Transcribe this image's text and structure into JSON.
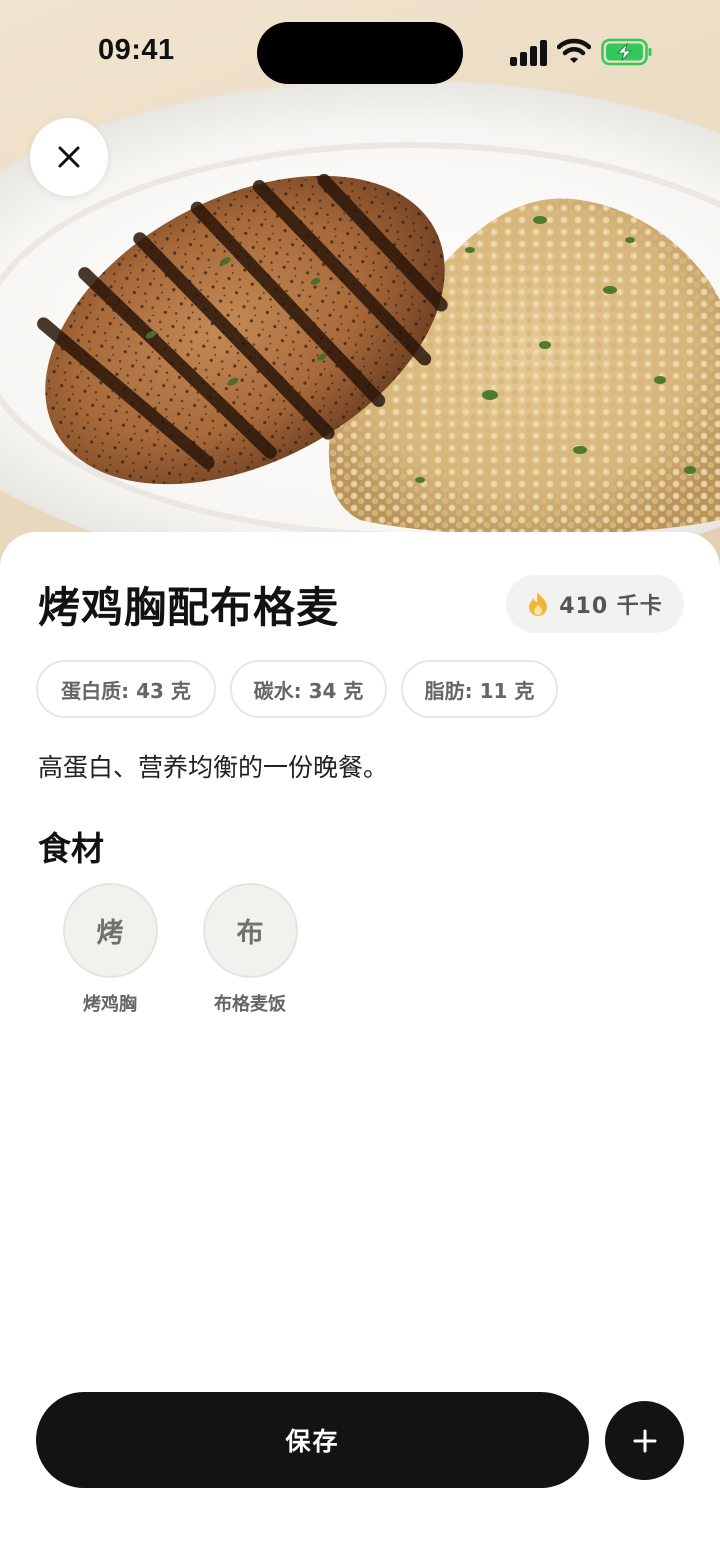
{
  "status_bar": {
    "time": "09:41"
  },
  "meal": {
    "title": "烤鸡胸配布格麦",
    "calories": "410 千卡",
    "macros": [
      {
        "label": "蛋白质: 43 克"
      },
      {
        "label": "碳水: 34 克"
      },
      {
        "label": "脂肪: 11 克"
      }
    ],
    "description": "高蛋白、营养均衡的一份晚餐。"
  },
  "ingredients": {
    "heading": "食材",
    "items": [
      {
        "initial": "烤",
        "label": "烤鸡胸"
      },
      {
        "initial": "布",
        "label": "布格麦饭"
      }
    ]
  },
  "actions": {
    "save_label": "保存"
  },
  "icons": {
    "close": "close-icon",
    "calories": "flame-icon",
    "add": "plus-icon"
  },
  "colors": {
    "primary_button": "#121414",
    "flame": "#f2b53a",
    "battery_fill": "#34c759"
  }
}
